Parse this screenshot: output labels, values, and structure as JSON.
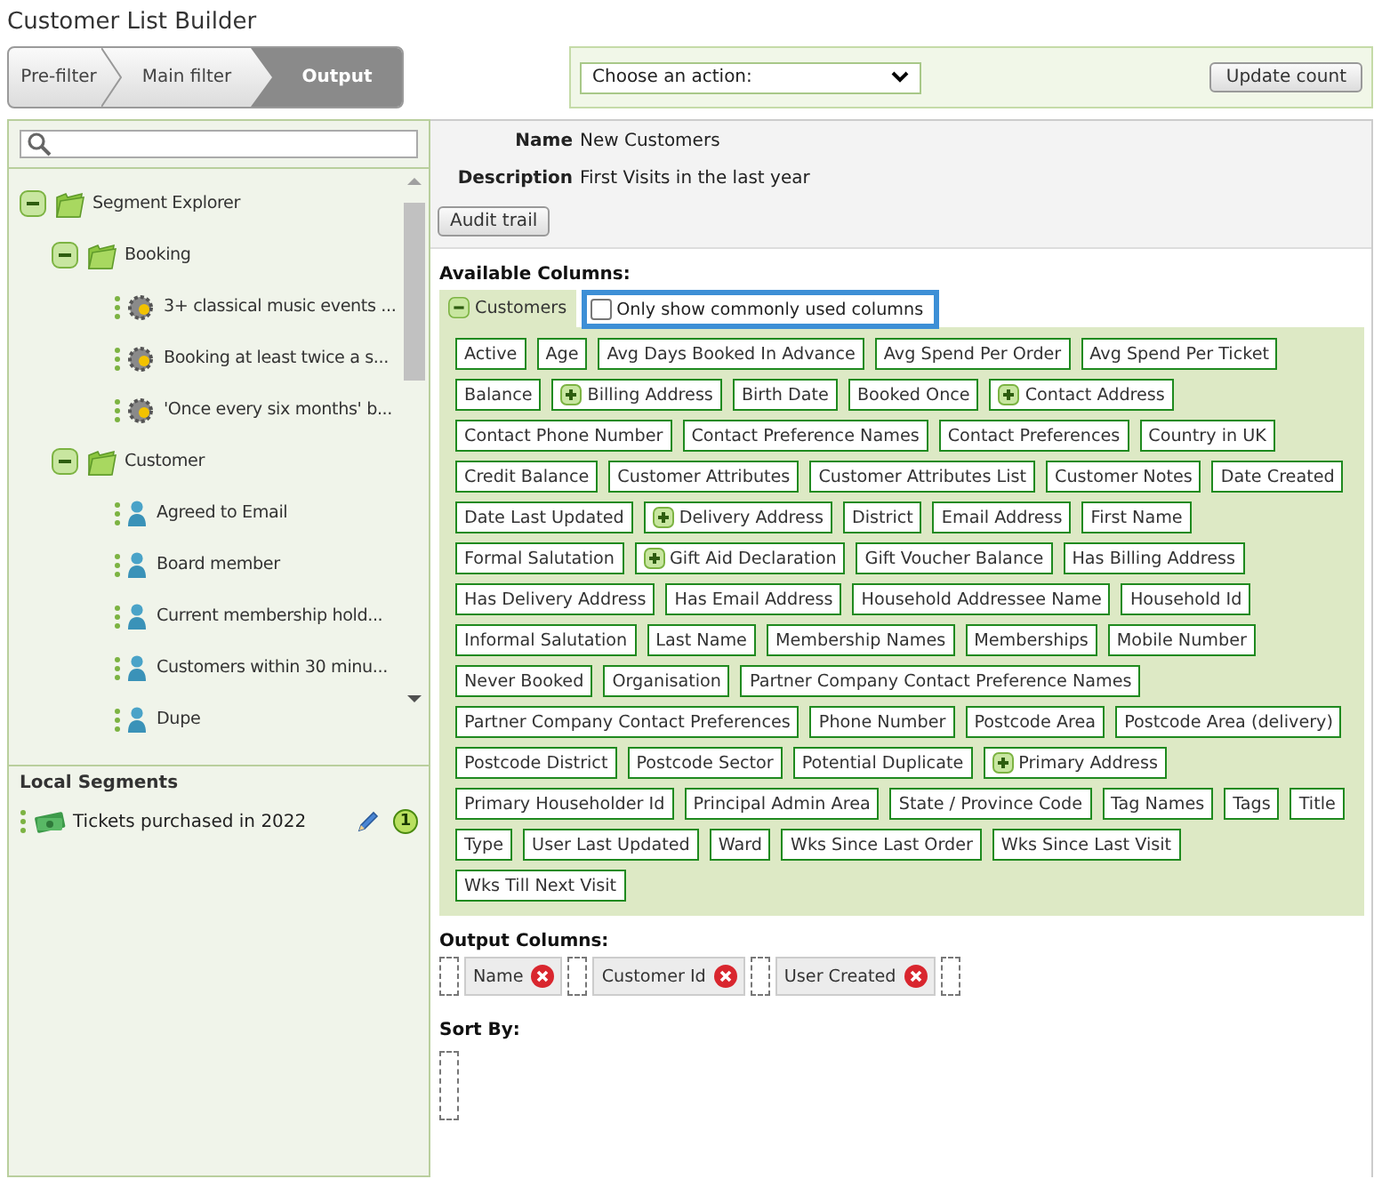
{
  "title": "Customer List Builder",
  "steps": [
    {
      "label": "Pre-filter",
      "selected": false
    },
    {
      "label": "Main filter",
      "selected": false
    },
    {
      "label": "Output",
      "selected": true
    }
  ],
  "action_bar": {
    "select": "Choose an action:",
    "button": "Update count"
  },
  "sidebar": {
    "tree": [
      {
        "label": "Segment Explorer",
        "kind": "folder",
        "expanded": true,
        "children": [
          {
            "label": "Booking",
            "kind": "folder",
            "expanded": true,
            "children": [
              {
                "label": "3+ classical music events ...",
                "kind": "rule"
              },
              {
                "label": "Booking at least twice a s...",
                "kind": "rule"
              },
              {
                "label": "'Once every six months' b...",
                "kind": "rule"
              }
            ]
          },
          {
            "label": "Customer",
            "kind": "folder",
            "expanded": true,
            "children": [
              {
                "label": "Agreed to Email",
                "kind": "person"
              },
              {
                "label": "Board member",
                "kind": "person"
              },
              {
                "label": "Current membership hold...",
                "kind": "person"
              },
              {
                "label": "Customers within 30 minu...",
                "kind": "person"
              },
              {
                "label": "Dupe",
                "kind": "person"
              }
            ]
          }
        ]
      }
    ],
    "local_segments": {
      "title": "Local Segments",
      "items": [
        {
          "label": "Tickets purchased in 2022",
          "count": "1"
        }
      ]
    }
  },
  "details": {
    "name_label": "Name",
    "name": "New Customers",
    "description_label": "Description",
    "description": "First Visits in the last year",
    "audit_button": "Audit trail"
  },
  "available_columns": {
    "heading": "Available Columns:",
    "group": {
      "label": "Customers",
      "expanded": true
    },
    "common_only": {
      "label": "Only show commonly used columns",
      "checked": false
    },
    "columns": [
      {
        "label": "Active",
        "kind": "field"
      },
      {
        "label": "Age",
        "kind": "field"
      },
      {
        "label": "Avg Days Booked In Advance",
        "kind": "field"
      },
      {
        "label": "Avg Spend Per Order",
        "kind": "field"
      },
      {
        "label": "Avg Spend Per Ticket",
        "kind": "field"
      },
      {
        "label": "Balance",
        "kind": "field"
      },
      {
        "label": "Billing Address",
        "kind": "group"
      },
      {
        "label": "Birth Date",
        "kind": "field"
      },
      {
        "label": "Booked Once",
        "kind": "field"
      },
      {
        "label": "Contact Address",
        "kind": "group"
      },
      {
        "label": "Contact Phone Number",
        "kind": "field"
      },
      {
        "label": "Contact Preference Names",
        "kind": "field"
      },
      {
        "label": "Contact Preferences",
        "kind": "field"
      },
      {
        "label": "Country in UK",
        "kind": "field"
      },
      {
        "label": "Credit Balance",
        "kind": "field"
      },
      {
        "label": "Customer Attributes",
        "kind": "field"
      },
      {
        "label": "Customer Attributes List",
        "kind": "field"
      },
      {
        "label": "Customer Notes",
        "kind": "field"
      },
      {
        "label": "Date Created",
        "kind": "field"
      },
      {
        "label": "Date Last Updated",
        "kind": "field"
      },
      {
        "label": "Delivery Address",
        "kind": "group"
      },
      {
        "label": "District",
        "kind": "field"
      },
      {
        "label": "Email Address",
        "kind": "field"
      },
      {
        "label": "First Name",
        "kind": "field"
      },
      {
        "label": "Formal Salutation",
        "kind": "field"
      },
      {
        "label": "Gift Aid Declaration",
        "kind": "group"
      },
      {
        "label": "Gift Voucher Balance",
        "kind": "field"
      },
      {
        "label": "Has Billing Address",
        "kind": "field"
      },
      {
        "label": "Has Delivery Address",
        "kind": "field"
      },
      {
        "label": "Has Email Address",
        "kind": "field"
      },
      {
        "label": "Household Addressee Name",
        "kind": "field"
      },
      {
        "label": "Household Id",
        "kind": "field"
      },
      {
        "label": "Informal Salutation",
        "kind": "field"
      },
      {
        "label": "Last Name",
        "kind": "field"
      },
      {
        "label": "Membership Names",
        "kind": "field"
      },
      {
        "label": "Memberships",
        "kind": "field"
      },
      {
        "label": "Mobile Number",
        "kind": "field"
      },
      {
        "label": "Never Booked",
        "kind": "field"
      },
      {
        "label": "Organisation",
        "kind": "field"
      },
      {
        "label": "Partner Company Contact Preference Names",
        "kind": "field"
      },
      {
        "label": "Partner Company Contact Preferences",
        "kind": "field"
      },
      {
        "label": "Phone Number",
        "kind": "field"
      },
      {
        "label": "Postcode Area",
        "kind": "field"
      },
      {
        "label": "Postcode Area (delivery)",
        "kind": "field"
      },
      {
        "label": "Postcode District",
        "kind": "field"
      },
      {
        "label": "Postcode Sector",
        "kind": "field"
      },
      {
        "label": "Potential Duplicate",
        "kind": "field"
      },
      {
        "label": "Primary Address",
        "kind": "group"
      },
      {
        "label": "Primary Householder Id",
        "kind": "field"
      },
      {
        "label": "Principal Admin Area",
        "kind": "field"
      },
      {
        "label": "State / Province Code",
        "kind": "field"
      },
      {
        "label": "Tag Names",
        "kind": "field"
      },
      {
        "label": "Tags",
        "kind": "field"
      },
      {
        "label": "Title",
        "kind": "field"
      },
      {
        "label": "Type",
        "kind": "field"
      },
      {
        "label": "User Last Updated",
        "kind": "field"
      },
      {
        "label": "Ward",
        "kind": "field"
      },
      {
        "label": "Wks Since Last Order",
        "kind": "field"
      },
      {
        "label": "Wks Since Last Visit",
        "kind": "field"
      },
      {
        "label": "Wks Till Next Visit",
        "kind": "field"
      }
    ]
  },
  "output_columns": {
    "heading": "Output Columns:",
    "items": [
      {
        "label": "Name"
      },
      {
        "label": "Customer Id"
      },
      {
        "label": "User Created"
      }
    ]
  },
  "sort_by": {
    "heading": "Sort By:"
  }
}
